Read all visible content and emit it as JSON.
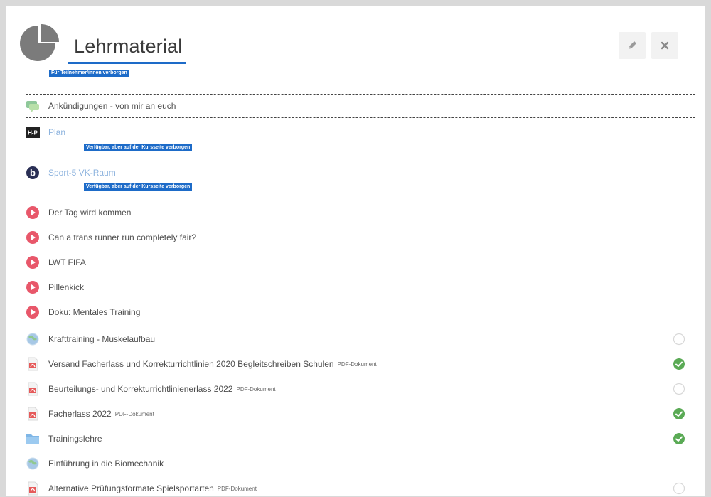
{
  "section": {
    "title": "Lehrmaterial",
    "hidden_badge": "Für Teilnehmer/innen verborgen",
    "edit_icon": "pencil-icon",
    "close_icon": "close-icon"
  },
  "colors": {
    "accent": "#1d6bc8",
    "complete": "#5aaa55",
    "video": "#e8576a"
  },
  "activities": [
    {
      "name": "Ankündigungen - von mir an euch",
      "icon": "forum-icon",
      "suffix": "",
      "link": false,
      "completion": "none"
    },
    {
      "name": "Plan",
      "icon": "h5p-icon",
      "suffix": "",
      "link": true,
      "completion": "none",
      "badge": "Verfügbar, aber auf der Kursseite verborgen"
    },
    {
      "name": "Sport-5 VK-Raum",
      "icon": "bigbluebutton-icon",
      "suffix": "",
      "link": true,
      "completion": "none",
      "badge": "Verfügbar, aber auf der Kursseite verborgen"
    },
    {
      "name": "Der Tag wird kommen",
      "icon": "video-icon",
      "suffix": "",
      "link": false,
      "completion": "none"
    },
    {
      "name": "Can a trans runner run completely fair?",
      "icon": "video-icon",
      "suffix": "",
      "link": false,
      "completion": "none"
    },
    {
      "name": "LWT FIFA",
      "icon": "video-icon",
      "suffix": "",
      "link": false,
      "completion": "none"
    },
    {
      "name": "Pillenkick",
      "icon": "video-icon",
      "suffix": "",
      "link": false,
      "completion": "none"
    },
    {
      "name": "Doku: Mentales Training",
      "icon": "video-icon",
      "suffix": "",
      "link": false,
      "completion": "none"
    },
    {
      "name": "Krafttraining - Muskelaufbau",
      "icon": "url-icon",
      "suffix": "",
      "link": false,
      "completion": "incomplete"
    },
    {
      "name": "Versand Facherlass und Korrekturrichtlinien 2020 Begleitschreiben Schulen",
      "icon": "pdf-icon",
      "suffix": "PDF-Dokument",
      "link": false,
      "completion": "complete"
    },
    {
      "name": "Beurteilungs- und Korrekturrichtlinienerlass 2022",
      "icon": "pdf-icon",
      "suffix": "PDF-Dokument",
      "link": false,
      "completion": "incomplete"
    },
    {
      "name": "Facherlass 2022",
      "icon": "pdf-icon",
      "suffix": "PDF-Dokument",
      "link": false,
      "completion": "complete"
    },
    {
      "name": "Trainingslehre",
      "icon": "folder-icon",
      "suffix": "",
      "link": false,
      "completion": "complete"
    },
    {
      "name": "Einführung in die Biomechanik",
      "icon": "url-icon",
      "suffix": "",
      "link": false,
      "completion": "none"
    },
    {
      "name": "Alternative Prüfungsformate Spielsportarten",
      "icon": "pdf-icon",
      "suffix": "PDF-Dokument",
      "link": false,
      "completion": "incomplete"
    }
  ]
}
